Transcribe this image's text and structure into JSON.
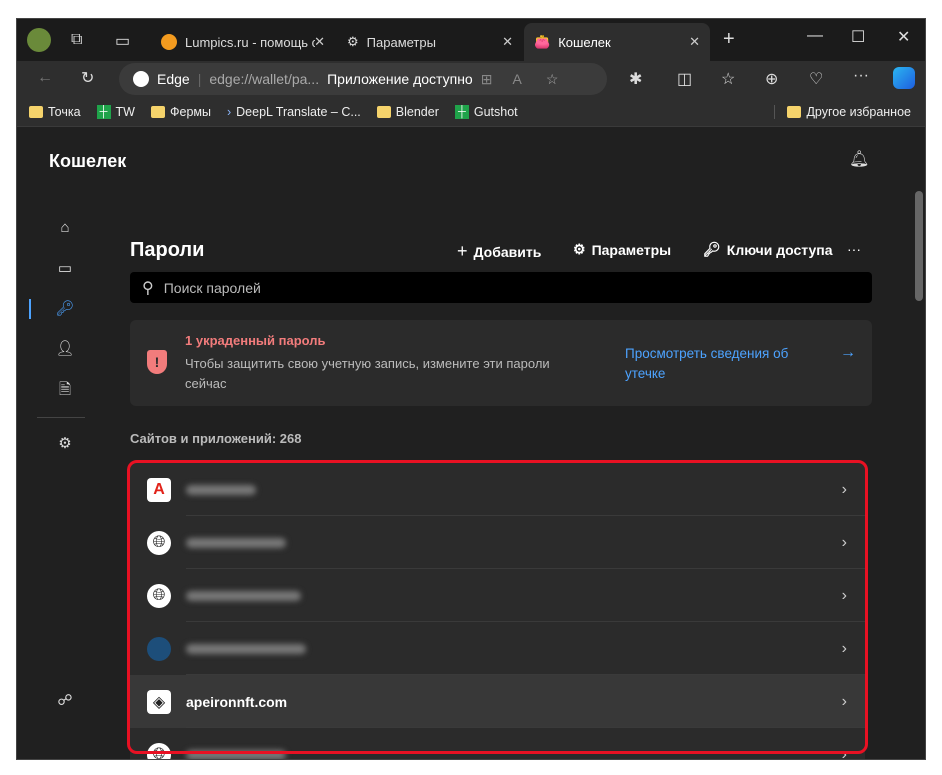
{
  "tabs": [
    {
      "label": "Lumpics.ru - помощь с"
    },
    {
      "label": "Параметры"
    },
    {
      "label": "Кошелек"
    }
  ],
  "toolbar": {
    "site_label": "Edge",
    "url": "edge://wallet/pa...",
    "app_available": "Приложение доступно"
  },
  "bookmarks": [
    {
      "label": "Точка",
      "icon": "folder"
    },
    {
      "label": "TW",
      "icon": "tw"
    },
    {
      "label": "Фермы",
      "icon": "folder"
    },
    {
      "label": "DeepL Translate – C...",
      "icon": "deepl"
    },
    {
      "label": "Blender",
      "icon": "folder"
    },
    {
      "label": "Gutshot",
      "icon": "tw"
    }
  ],
  "other_favorites": "Другое избранное",
  "wallet": {
    "title": "Кошелек"
  },
  "passwords": {
    "title": "Пароли",
    "add": "Добавить",
    "settings": "Параметры",
    "passkeys": "Ключи доступа",
    "search_placeholder": "Поиск паролей",
    "alert": {
      "title": "1 украденный пароль",
      "text": "Чтобы защитить свою учетную запись, измените эти пароли сейчас",
      "link": "Просмотреть сведения об утечке"
    },
    "count_label": "Сайтов и приложений: 268",
    "rows": [
      {
        "icon": "adobe"
      },
      {
        "icon": "globe"
      },
      {
        "icon": "globe"
      },
      {
        "icon": "site"
      },
      {
        "icon": "apeiron",
        "name": "apeironnft.com"
      },
      {
        "icon": "globe"
      }
    ]
  },
  "colors": {
    "accent": "#4da3ff",
    "danger": "#f27c7c",
    "highlight": "#e81123"
  }
}
